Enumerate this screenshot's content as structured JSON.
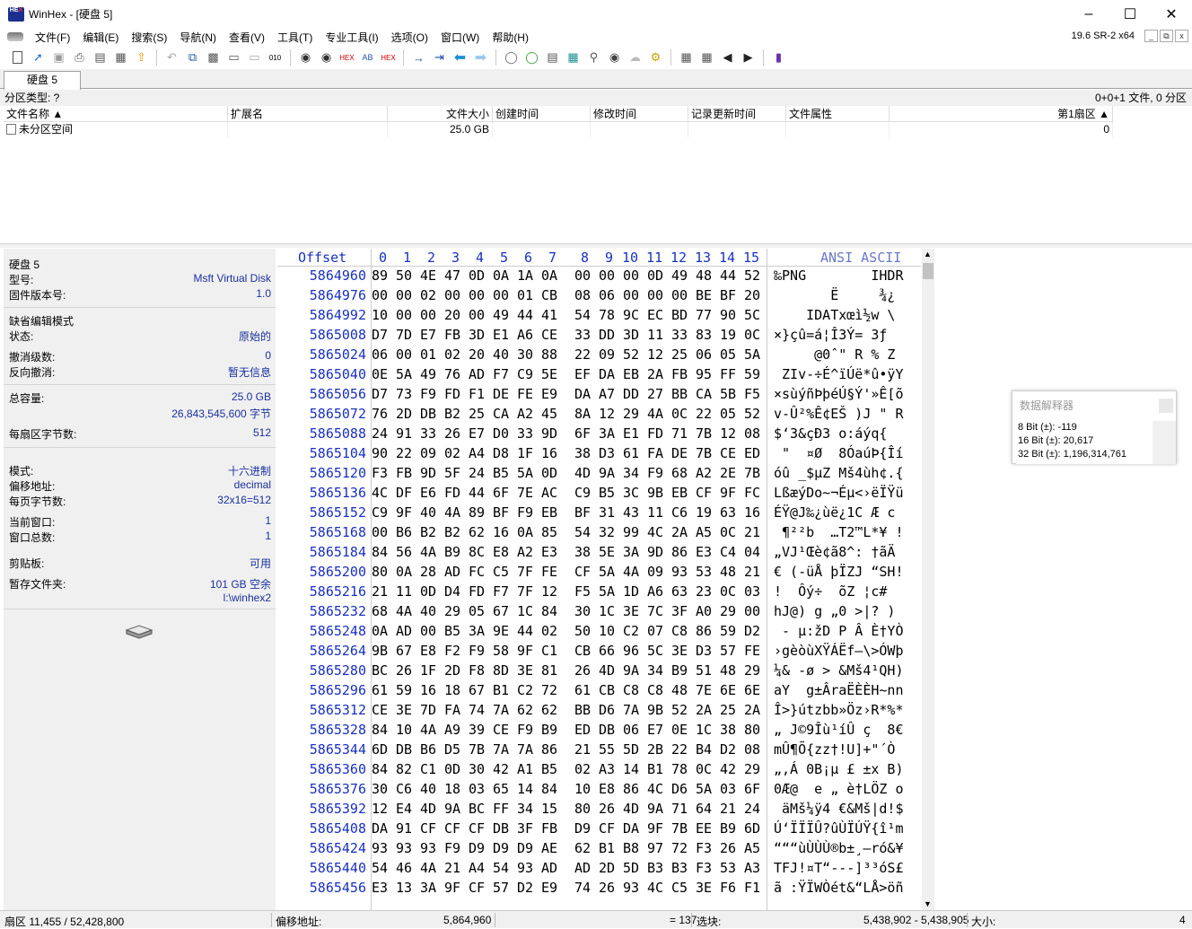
{
  "window": {
    "title": "WinHex - [硬盘 5]",
    "version": "19.6 SR-2 x64"
  },
  "menu": [
    "文件(F)",
    "编辑(E)",
    "搜索(S)",
    "导航(N)",
    "查看(V)",
    "工具(T)",
    "专业工具(I)",
    "选项(O)",
    "窗口(W)",
    "帮助(H)"
  ],
  "tab": {
    "label": "硬盘 5"
  },
  "partition": {
    "type_label": "分区类型: ?",
    "summary": "0+0+1 文件, 0 分区"
  },
  "file_list": {
    "columns": [
      "文件名称",
      "扩展名",
      "文件大小",
      "创建时间",
      "修改时间",
      "记录更新时间",
      "文件属性",
      "第1扇区"
    ],
    "rows": [
      {
        "name": "未分区空间",
        "ext": "",
        "size": "25.0 GB",
        "created": "",
        "modified": "",
        "updated": "",
        "attr": "",
        "first_sector": "0"
      }
    ]
  },
  "info": {
    "disk_title": "硬盘 5",
    "model_k": "型号:",
    "model_v": "Msft Virtual Disk",
    "fw_k": "固件版本号:",
    "fw_v": "1.0",
    "edit_mode_title": "缺省编辑模式",
    "state_k": "状态:",
    "state_v": "原始的",
    "undo_level_k": "撤消级数:",
    "undo_level_v": "0",
    "reverse_undo_k": "反向撤消:",
    "reverse_undo_v": "暂无信息",
    "capacity_k": "总容量:",
    "capacity_v": "25.0 GB",
    "capacity_bytes": "26,843,545,600 字节",
    "bps_k": "每扇区字节数:",
    "bps_v": "512",
    "mode_k": "模式:",
    "mode_v": "十六进制",
    "offset_k": "偏移地址:",
    "offset_v": "decimal",
    "bpp_k": "每页字节数:",
    "bpp_v": "32x16=512",
    "curwin_k": "当前窗口:",
    "curwin_v": "1",
    "totwin_k": "窗口总数:",
    "totwin_v": "1",
    "clip_k": "剪贴板:",
    "clip_v": "可用",
    "temp_k": "暂存文件夹:",
    "temp_v": "101 GB 空余",
    "temp_path": "l:\\winhex2"
  },
  "hex": {
    "offset_label": "Offset",
    "col_labels": [
      "0",
      "1",
      "2",
      "3",
      "4",
      "5",
      "6",
      "7",
      "8",
      "9",
      "10",
      "11",
      "12",
      "13",
      "14",
      "15"
    ],
    "ascii_label": "ANSI ASCII",
    "rows": [
      {
        "off": "5864960",
        "b": [
          "89",
          "50",
          "4E",
          "47",
          "0D",
          "0A",
          "1A",
          "0A",
          "00",
          "00",
          "00",
          "0D",
          "49",
          "48",
          "44",
          "52"
        ],
        "a": "‰PNG        IHDR"
      },
      {
        "off": "5864976",
        "b": [
          "00",
          "00",
          "02",
          "00",
          "00",
          "00",
          "01",
          "CB",
          "08",
          "06",
          "00",
          "00",
          "00",
          "BE",
          "BF",
          "20"
        ],
        "a": "       Ë     ¾¿ "
      },
      {
        "off": "5864992",
        "b": [
          "10",
          "00",
          "00",
          "20",
          "00",
          "49",
          "44",
          "41",
          "54",
          "78",
          "9C",
          "EC",
          "BD",
          "77",
          "90",
          "5C"
        ],
        "a": "    IDATxœì½w \\"
      },
      {
        "off": "5865008",
        "b": [
          "D7",
          "7D",
          "E7",
          "FB",
          "3D",
          "E1",
          "A6",
          "CE",
          "33",
          "DD",
          "3D",
          "11",
          "33",
          "83",
          "19",
          "0C"
        ],
        "a": "×}çû=á¦Î3Ý= 3ƒ  "
      },
      {
        "off": "5865024",
        "b": [
          "06",
          "00",
          "01",
          "02",
          "20",
          "40",
          "30",
          "88",
          "22",
          "09",
          "52",
          "12",
          "25",
          "06",
          "05",
          "5A"
        ],
        "a": "     @0ˆ\" R % Z"
      },
      {
        "off": "5865040",
        "b": [
          "0E",
          "5A",
          "49",
          "76",
          "AD",
          "F7",
          "C9",
          "5E",
          "EF",
          "DA",
          "EB",
          "2A",
          "FB",
          "95",
          "FF",
          "59"
        ],
        "a": " ZIv-÷É^ïÚë*û•ÿY"
      },
      {
        "off": "5865056",
        "b": [
          "D7",
          "73",
          "F9",
          "FD",
          "F1",
          "DE",
          "FE",
          "E9",
          "DA",
          "A7",
          "DD",
          "27",
          "BB",
          "CA",
          "5B",
          "F5"
        ],
        "a": "×sùýñÞþéÚ§Ý'»Ê[õ"
      },
      {
        "off": "5865072",
        "b": [
          "76",
          "2D",
          "DB",
          "B2",
          "25",
          "CA",
          "A2",
          "45",
          "8A",
          "12",
          "29",
          "4A",
          "0C",
          "22",
          "05",
          "52"
        ],
        "a": "v-Û²%Ê¢EŠ )J \" R"
      },
      {
        "off": "5865088",
        "b": [
          "24",
          "91",
          "33",
          "26",
          "E7",
          "D0",
          "33",
          "9D",
          "6F",
          "3A",
          "E1",
          "FD",
          "71",
          "7B",
          "12",
          "08"
        ],
        "a": "$‘3&çÐ3 o:áýq{  "
      },
      {
        "off": "5865104",
        "b": [
          "90",
          "22",
          "09",
          "02",
          "A4",
          "D8",
          "1F",
          "16",
          "38",
          "D3",
          "61",
          "FA",
          "DE",
          "7B",
          "CE",
          "ED"
        ],
        "a": " \"  ¤Ø  8ÓaúÞ{Îí"
      },
      {
        "off": "5865120",
        "b": [
          "F3",
          "FB",
          "9D",
          "5F",
          "24",
          "B5",
          "5A",
          "0D",
          "4D",
          "9A",
          "34",
          "F9",
          "68",
          "A2",
          "2E",
          "7B"
        ],
        "a": "óû _$µZ Mš4ùh¢.{"
      },
      {
        "off": "5865136",
        "b": [
          "4C",
          "DF",
          "E6",
          "FD",
          "44",
          "6F",
          "7E",
          "AC",
          "C9",
          "B5",
          "3C",
          "9B",
          "EB",
          "CF",
          "9F",
          "FC"
        ],
        "a": "LßæýDo~¬Éµ<›ëÏŸü"
      },
      {
        "off": "5865152",
        "b": [
          "C9",
          "9F",
          "40",
          "4A",
          "89",
          "BF",
          "F9",
          "EB",
          "BF",
          "31",
          "43",
          "11",
          "C6",
          "19",
          "63",
          "16"
        ],
        "a": "ÉŸ@J‰¿ùë¿1C Æ c "
      },
      {
        "off": "5865168",
        "b": [
          "00",
          "B6",
          "B2",
          "B2",
          "62",
          "16",
          "0A",
          "85",
          "54",
          "32",
          "99",
          "4C",
          "2A",
          "A5",
          "0C",
          "21"
        ],
        "a": " ¶²²b  …T2™L*¥ !"
      },
      {
        "off": "5865184",
        "b": [
          "84",
          "56",
          "4A",
          "B9",
          "8C",
          "E8",
          "A2",
          "E3",
          "38",
          "5E",
          "3A",
          "9D",
          "86",
          "E3",
          "C4",
          "04"
        ],
        "a": "„VJ¹Œè¢ã8^: †ãÄ "
      },
      {
        "off": "5865200",
        "b": [
          "80",
          "0A",
          "28",
          "AD",
          "FC",
          "C5",
          "7F",
          "FE",
          "CF",
          "5A",
          "4A",
          "09",
          "93",
          "53",
          "48",
          "21"
        ],
        "a": "€ (-üÅ þÏZJ “SH!"
      },
      {
        "off": "5865216",
        "b": [
          "21",
          "11",
          "0D",
          "D4",
          "FD",
          "F7",
          "7F",
          "12",
          "F5",
          "5A",
          "1D",
          "A6",
          "63",
          "23",
          "0C",
          "03"
        ],
        "a": "!  Ôý÷  õZ ¦c#  "
      },
      {
        "off": "5865232",
        "b": [
          "68",
          "4A",
          "40",
          "29",
          "05",
          "67",
          "1C",
          "84",
          "30",
          "1C",
          "3E",
          "7C",
          "3F",
          "A0",
          "29",
          "00"
        ],
        "a": "hJ@) g „0 >|? ) "
      },
      {
        "off": "5865248",
        "b": [
          "0A",
          "AD",
          "00",
          "B5",
          "3A",
          "9E",
          "44",
          "02",
          "50",
          "10",
          "C2",
          "07",
          "C8",
          "86",
          "59",
          "D2"
        ],
        "a": " - µ:žD P Â È†YÒ"
      },
      {
        "off": "5865264",
        "b": [
          "9B",
          "67",
          "E8",
          "F2",
          "F9",
          "58",
          "9F",
          "C1",
          "CB",
          "66",
          "96",
          "5C",
          "3E",
          "D3",
          "57",
          "FE"
        ],
        "a": "›gèòùXŸÁËf–\\>ÓWþ"
      },
      {
        "off": "5865280",
        "b": [
          "BC",
          "26",
          "1F",
          "2D",
          "F8",
          "8D",
          "3E",
          "81",
          "26",
          "4D",
          "9A",
          "34",
          "B9",
          "51",
          "48",
          "29"
        ],
        "a": "¼& -ø > &Mš4¹QH)"
      },
      {
        "off": "5865296",
        "b": [
          "61",
          "59",
          "16",
          "18",
          "67",
          "B1",
          "C2",
          "72",
          "61",
          "CB",
          "C8",
          "C8",
          "48",
          "7E",
          "6E",
          "6E"
        ],
        "a": "aY  g±ÂraËÈÈH~nn"
      },
      {
        "off": "5865312",
        "b": [
          "CE",
          "3E",
          "7D",
          "FA",
          "74",
          "7A",
          "62",
          "62",
          "BB",
          "D6",
          "7A",
          "9B",
          "52",
          "2A",
          "25",
          "2A"
        ],
        "a": "Î>}útzbb»Öz›R*%*"
      },
      {
        "off": "5865328",
        "b": [
          "84",
          "10",
          "4A",
          "A9",
          "39",
          "CE",
          "F9",
          "B9",
          "ED",
          "DB",
          "06",
          "E7",
          "0E",
          "1C",
          "38",
          "80"
        ],
        "a": "„ J©9Îù¹íÛ ç  8€"
      },
      {
        "off": "5865344",
        "b": [
          "6D",
          "DB",
          "B6",
          "D5",
          "7B",
          "7A",
          "7A",
          "86",
          "21",
          "55",
          "5D",
          "2B",
          "22",
          "B4",
          "D2",
          "08"
        ],
        "a": "mÛ¶Õ{zz†!U]+\"´Ò "
      },
      {
        "off": "5865360",
        "b": [
          "84",
          "82",
          "C1",
          "0D",
          "30",
          "42",
          "A1",
          "B5",
          "02",
          "A3",
          "14",
          "B1",
          "78",
          "0C",
          "42",
          "29"
        ],
        "a": "„‚Á 0B¡µ £ ±x B)"
      },
      {
        "off": "5865376",
        "b": [
          "30",
          "C6",
          "40",
          "18",
          "03",
          "65",
          "14",
          "84",
          "10",
          "E8",
          "86",
          "4C",
          "D6",
          "5A",
          "03",
          "6F"
        ],
        "a": "0Æ@  e „ è†LÖZ o"
      },
      {
        "off": "5865392",
        "b": [
          "12",
          "E4",
          "4D",
          "9A",
          "BC",
          "FF",
          "34",
          "15",
          "80",
          "26",
          "4D",
          "9A",
          "71",
          "64",
          "21",
          "24"
        ],
        "a": " äMš¼ÿ4 €&Mš|d!$"
      },
      {
        "off": "5865408",
        "b": [
          "DA",
          "91",
          "CF",
          "CF",
          "CF",
          "DB",
          "3F",
          "FB",
          "D9",
          "CF",
          "DA",
          "9F",
          "7B",
          "EE",
          "B9",
          "6D"
        ],
        "a": "Ú‘ÏÏÏÛ?ûÙÏÚŸ{î¹m"
      },
      {
        "off": "5865424",
        "b": [
          "93",
          "93",
          "93",
          "F9",
          "D9",
          "D9",
          "D9",
          "AE",
          "62",
          "B1",
          "B8",
          "97",
          "72",
          "F3",
          "26",
          "A5"
        ],
        "a": "“““ùÙÙÙ®b±¸—ró&¥"
      },
      {
        "off": "5865440",
        "b": [
          "54",
          "46",
          "4A",
          "21",
          "A4",
          "54",
          "93",
          "AD",
          "AD",
          "2D",
          "5D",
          "B3",
          "B3",
          "F3",
          "53",
          "A3"
        ],
        "a": "TFJ!¤T“---]³³óS£"
      },
      {
        "off": "5865456",
        "b": [
          "E3",
          "13",
          "3A",
          "9F",
          "CF",
          "57",
          "D2",
          "E9",
          "74",
          "26",
          "93",
          "4C",
          "C5",
          "3E",
          "F6",
          "F1"
        ],
        "a": "ã :ŸÏWÒét&“LÅ>öñ"
      }
    ]
  },
  "interpreter": {
    "title": "数据解释器",
    "rows": [
      "8 Bit (±): -119",
      "16 Bit (±): 20,617",
      "32 Bit (±): 1,196,314,761"
    ]
  },
  "status": {
    "sector": "扇区 11,455 / 52,428,800",
    "offset_label": "偏移地址:",
    "offset_value": "5,864,960",
    "eq_value": "= 137",
    "sel_label": "选块:",
    "sel_value": "5,438,902 - 5,438,905",
    "size_label": "大小:",
    "size_value": "4"
  }
}
